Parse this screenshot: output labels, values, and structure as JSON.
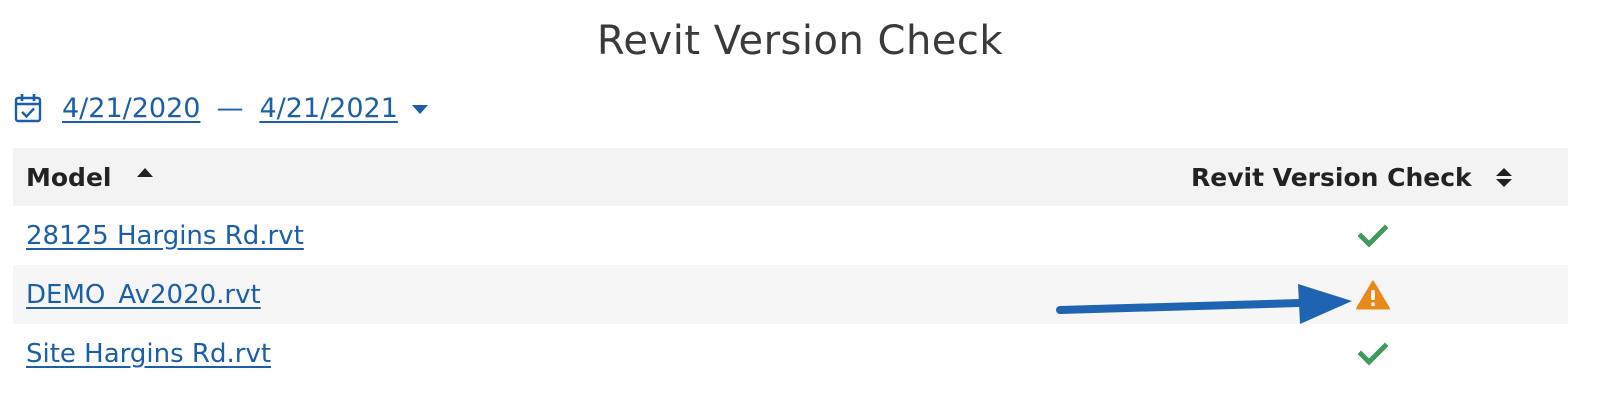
{
  "page": {
    "title": "Revit Version Check"
  },
  "date_range": {
    "icon": "calendar-check-icon",
    "start": "4/21/2020",
    "separator": "—",
    "end": "4/21/2021"
  },
  "table": {
    "columns": [
      {
        "label": "Model",
        "sort": "ascending"
      },
      {
        "label": "Revit Version Check",
        "sort": "none"
      }
    ],
    "rows": [
      {
        "model": "28125 Hargins Rd.rvt",
        "status": "ok",
        "status_icon": "check-icon"
      },
      {
        "model": "DEMO_Av2020.rvt",
        "status": "warning",
        "status_icon": "warning-icon"
      },
      {
        "model": "Site Hargins Rd.rvt",
        "status": "ok",
        "status_icon": "check-icon"
      }
    ]
  },
  "colors": {
    "link": "#1a5fa8",
    "ok": "#3f9a5b",
    "warning": "#e8891a",
    "annotation_arrow": "#1f63b3"
  }
}
